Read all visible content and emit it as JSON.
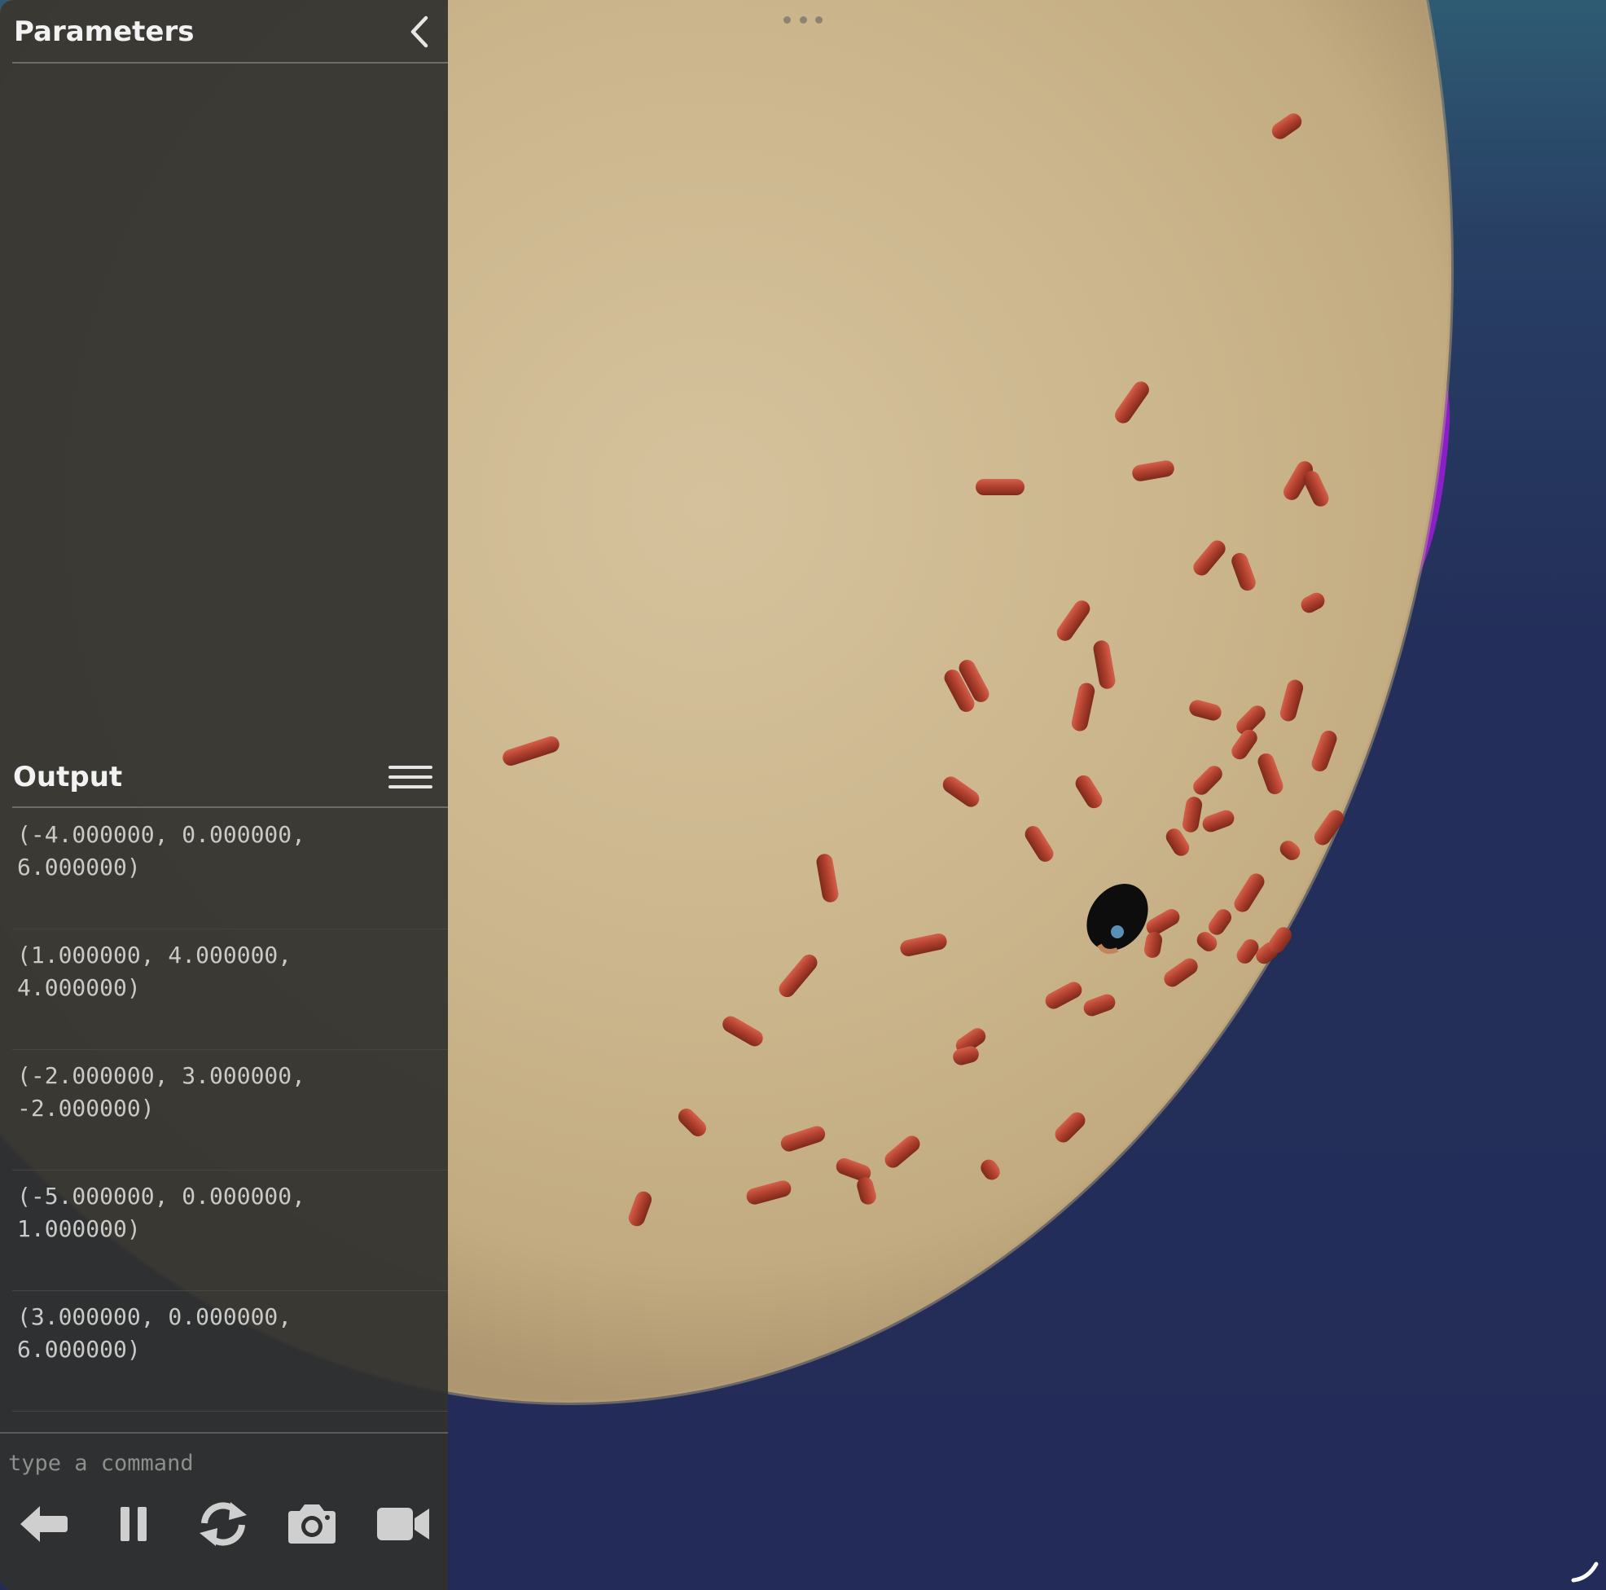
{
  "parameters_panel": {
    "title": "Parameters",
    "collapse_icon": "chevron-left-icon"
  },
  "output_panel": {
    "title": "Output",
    "menu_icon": "hamburger-menu-icon",
    "entries": [
      "(-4.000000, 0.000000, 6.000000)",
      "(1.000000, 4.000000, 4.000000)",
      "(-2.000000, 3.000000, -2.000000)",
      "(-5.000000, 0.000000, 1.000000)",
      "(3.000000, 0.000000, 6.000000)"
    ]
  },
  "command": {
    "placeholder": "type a command",
    "value": ""
  },
  "toolbar": {
    "buttons": [
      "back-arrow-icon",
      "pause-icon",
      "refresh-icon",
      "camera-icon",
      "video-camera-icon"
    ]
  },
  "viewport": {
    "top_menu_icon": "more-dots-icon",
    "resize_icon": "resize-handle-icon",
    "colors": {
      "background_top": "#2e5b73",
      "background_bottom": "#232c58",
      "planet": "#cfb98f",
      "particles": "#b3412f",
      "accent_purple": "#8a1fc8"
    }
  }
}
